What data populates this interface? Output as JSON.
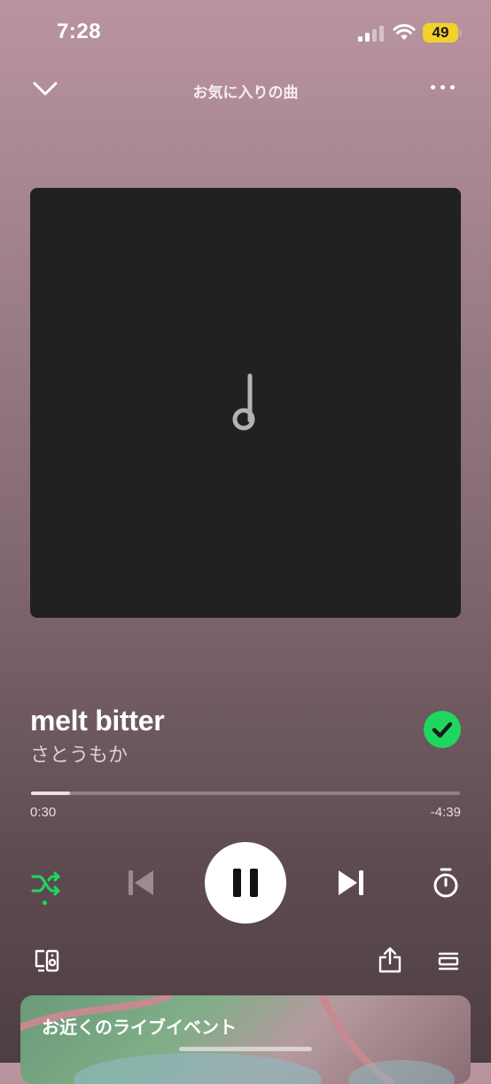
{
  "status_bar": {
    "time": "7:28",
    "battery": "49",
    "icons": [
      "cellular-signal-icon",
      "wifi-icon",
      "battery-icon"
    ]
  },
  "header": {
    "title": "お気に入りの曲",
    "icons": [
      "chevron-down-icon",
      "more-options-icon"
    ]
  },
  "artwork": {
    "placeholder_icon": "music-note-icon",
    "background": "#212121"
  },
  "track": {
    "title": "melt bitter",
    "artist": "さとうもか",
    "liked": true,
    "liked_icon": "check-circle-icon"
  },
  "progress": {
    "current": "0:30",
    "remaining": "-4:39",
    "fraction": 0.09
  },
  "controls": {
    "shuffle_active": true,
    "icons": [
      "shuffle-icon",
      "previous-icon",
      "pause-icon",
      "next-icon",
      "sleep-timer-icon"
    ],
    "accent": "#1ed760"
  },
  "bottom_bar": {
    "icons": [
      "connect-device-icon",
      "share-icon",
      "queue-icon"
    ]
  },
  "live_events": {
    "title": "お近くのライブイベント"
  }
}
